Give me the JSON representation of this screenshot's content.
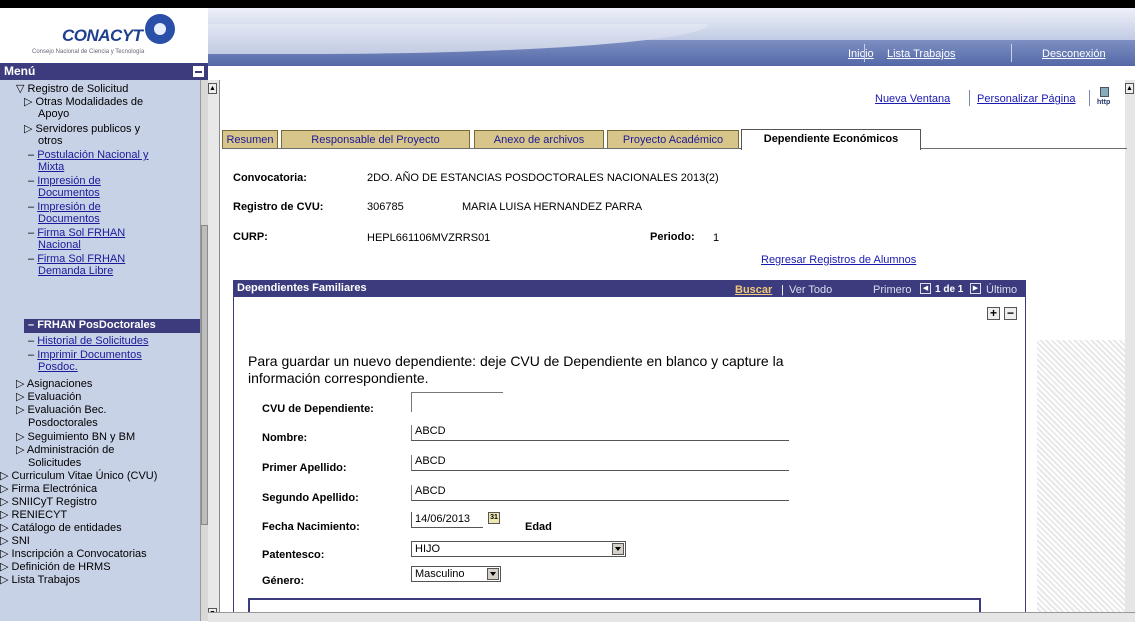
{
  "logo": {
    "name": "CONACYT",
    "subtitle": "Consejo Nacional de Ciencia y Tecnología"
  },
  "header": {
    "links": [
      "Inicio",
      "Lista Trabajos",
      "Desconexión"
    ]
  },
  "sidebar": {
    "title": "Menú",
    "items": [
      {
        "label": "▽ Registro de Solicitud"
      },
      {
        "label": "▷ Otras Modalidades de"
      },
      {
        "label": "Apoyo"
      },
      {
        "label": "▷ Servidores publicos y"
      },
      {
        "label": "otros"
      },
      {
        "label": "Postulación Nacional y"
      },
      {
        "label": "Mixta"
      },
      {
        "label": "Impresión de"
      },
      {
        "label": "Documentos"
      },
      {
        "label": "Impresión de"
      },
      {
        "label": "Documentos"
      },
      {
        "label": "Firma Sol FRHAN"
      },
      {
        "label": "Nacional"
      },
      {
        "label": "Firma Sol FRHAN"
      },
      {
        "label": "Demanda Libre"
      },
      {
        "label": "FRHAN PosDoctorales"
      },
      {
        "label": "Historial de Solicitudes"
      },
      {
        "label": "Imprimir Documentos"
      },
      {
        "label": "Posdoc."
      },
      {
        "label": "▷ Asignaciones"
      },
      {
        "label": "▷ Evaluación"
      },
      {
        "label": "▷ Evaluación Bec."
      },
      {
        "label": "Posdoctorales"
      },
      {
        "label": "▷ Seguimiento BN y BM"
      },
      {
        "label": "▷ Administración de"
      },
      {
        "label": "Solicitudes"
      },
      {
        "label": "▷ Curriculum Vitae Único (CVU)"
      },
      {
        "label": "▷ Firma Electrónica"
      },
      {
        "label": "▷ SNIICyT Registro"
      },
      {
        "label": "▷ RENIECYT"
      },
      {
        "label": "▷ Catálogo de entidades"
      },
      {
        "label": "▷ SNI"
      },
      {
        "label": "▷ Inscripción a Convocatorias"
      },
      {
        "label": "▷ Definición de HRMS"
      },
      {
        "label": "▷ Lista Trabajos"
      }
    ]
  },
  "toplinks": {
    "new_window": "Nueva Ventana",
    "personalize": "Personalizar Página",
    "http": "http"
  },
  "tabs": [
    {
      "label": "Resumen"
    },
    {
      "label": "Responsable del Proyecto"
    },
    {
      "label": "Anexo de archivos"
    },
    {
      "label": "Proyecto Académico"
    },
    {
      "label": "Dependiente Económicos"
    }
  ],
  "info": {
    "convocatoria_label": "Convocatoria:",
    "convocatoria_value": "2DO. AÑO DE ESTANCIAS POSDOCTORALES NACIONALES 2013(2)",
    "cvu_label": "Registro de CVU:",
    "cvu_value": "306785",
    "name_value": "MARIA LUISA HERNANDEZ PARRA",
    "curp_label": "CURP:",
    "curp_value": "HEPL661106MVZRRS01",
    "periodo_label": "Periodo:",
    "periodo_value": "1",
    "return_link": "Regresar Registros de Alumnos"
  },
  "grid": {
    "title": "Dependientes Familiares",
    "search": "Buscar",
    "sep": "|",
    "view_all": "Ver Todo",
    "first": "Primero",
    "count": "1 de 1",
    "last": "Último"
  },
  "form": {
    "note_line1": "Para guardar un nuevo dependiente: deje CVU de Dependiente en blanco y capture la",
    "note_line2": "información correspondiente.",
    "cvu_label": "CVU de Dependiente:",
    "cvu_value": "",
    "nombre_label": "Nombre:",
    "nombre_value": "ABCD",
    "apellido1_label": "Primer Apellido:",
    "apellido1_value": "ABCD",
    "apellido2_label": "Segundo Apellido:",
    "apellido2_value": "ABCD",
    "fecha_label": "Fecha Nacimiento:",
    "fecha_value": "14/06/2013",
    "edad_label": "Edad",
    "parentesco_label": "Patentesco:",
    "parentesco_value": "HIJO",
    "genero_label": "Género:",
    "genero_value": "Masculino"
  }
}
